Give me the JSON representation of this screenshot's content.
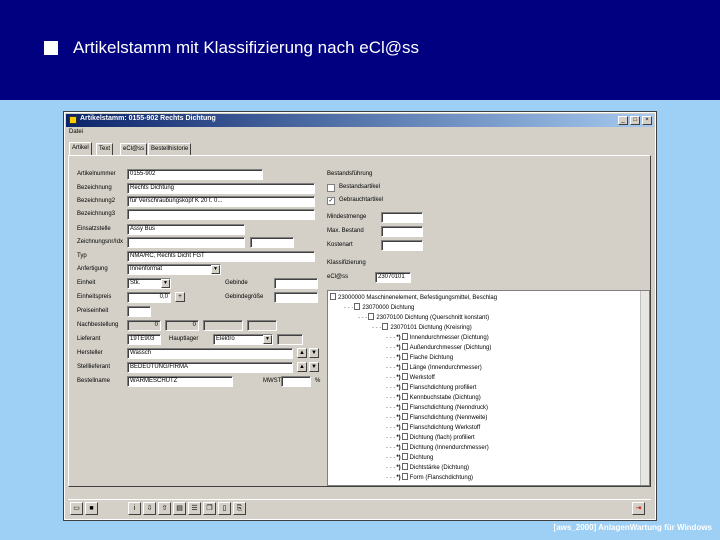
{
  "slide": {
    "title": "Artikelstamm mit Klassifizierung nach eCl@ss",
    "footer": "[aws_2000] AnlagenWartung für Windows"
  },
  "window": {
    "title": "Artikelstamm: 0155-902 Rechts Dichtung",
    "menu": [
      "Datei"
    ],
    "tabs": [
      "Artikel",
      "Text",
      "eCl@ss",
      "Bestellhistorie"
    ],
    "active_tab": "Artikel"
  },
  "form": {
    "artikelnummer": {
      "label": "Artikelnummer",
      "value": "0155-902"
    },
    "bezeichnung": {
      "label": "Bezeichnung",
      "value": "Rechts Dichtung"
    },
    "bezeichnung2": {
      "label": "Bezeichnung2",
      "value": "für Verschraubungskopf K 20 t. 0..."
    },
    "bezeichnung3": {
      "label": "Bezeichnung3",
      "value": ""
    },
    "einsatzstelle": {
      "label": "Einsatzstelle",
      "value": "Assy Bus"
    },
    "zeichnungsnr": {
      "label": "Zeichnungsnr/Idx",
      "value": ""
    },
    "typ": {
      "label": "Typ",
      "value": "NMA/RC, Rechts Dicht FGT"
    },
    "anfertigung": {
      "label": "Anfertigung",
      "value": "Innenformat"
    },
    "einheit": {
      "label": "Einheit",
      "value": "Stk."
    },
    "einheitspreis": {
      "label": "Einheitspreis",
      "value": "0,0"
    },
    "preiseinheit": {
      "label": "Preiseinheit",
      "value": ""
    },
    "nachbestellung": {
      "label": "Nachbestellung",
      "value": "0",
      "value2": "0"
    },
    "lieferant": {
      "label": "Lieferant",
      "value": "19TE903",
      "label2": "Hauptlager",
      "value2": "Elektro"
    },
    "hersteller": {
      "label": "Hersteller",
      "value": "Wassch"
    },
    "stelllieferant": {
      "label": "Stelllieferant",
      "value": "BEDEUTUNG/FIRMA"
    },
    "bestellname": {
      "label": "Bestellname",
      "value": "WÄRMESCHUTZ",
      "label2": "MWST",
      "value2": ""
    },
    "gebinde": {
      "label": "Gebinde",
      "value": ""
    },
    "gebindegroesse": {
      "label": "Gebindegröße",
      "value": ""
    }
  },
  "bestandsfuehrung": {
    "label": "Bestandsführung",
    "option1": {
      "label": "Bestandsartikel",
      "checked": false
    },
    "option2": {
      "label": "Gebrauchtartikel",
      "checked": true
    },
    "mindestmenge": {
      "label": "Mindestmenge",
      "value": ""
    },
    "mindestmenge2": {
      "label": "Max. Bestand",
      "value": ""
    },
    "kostenart": {
      "label": "Kostenart",
      "value": ""
    }
  },
  "klassifizierung": {
    "label": "Klassifizierung",
    "eclass_label": "eCl@ss",
    "eclass_value": "23070101",
    "tree": [
      {
        "text": "23000000 Maschinenelement, Befestigungsmittel, Beschlag",
        "indent": 0,
        "icon": true,
        "stars": ""
      },
      {
        "text": "23070000 Dichtung",
        "indent": 1,
        "icon": true,
        "stars": ""
      },
      {
        "text": "23070100 Dichtung (Querschnitt konstant)",
        "indent": 2,
        "icon": true,
        "stars": ""
      },
      {
        "text": "23070101 Dichtung (Kreisring)",
        "indent": 3,
        "icon": true,
        "stars": ""
      },
      {
        "text": "Innendurchmesser (Dichtung)",
        "indent": 4,
        "icon": true,
        "stars": "*)"
      },
      {
        "text": "Außendurchmesser (Dichtung)",
        "indent": 4,
        "icon": true,
        "stars": "*)"
      },
      {
        "text": "Flache Dichtung",
        "indent": 4,
        "icon": true,
        "stars": "*)"
      },
      {
        "text": "Länge (Innendurchmesser)",
        "indent": 4,
        "icon": true,
        "stars": "*)"
      },
      {
        "text": "Werkstoff",
        "indent": 4,
        "icon": true,
        "stars": "*)"
      },
      {
        "text": "Flanschdichtung profiliert",
        "indent": 4,
        "icon": true,
        "stars": "*)"
      },
      {
        "text": "Kennbuchstabe (Dichtung)",
        "indent": 4,
        "icon": true,
        "stars": "*)"
      },
      {
        "text": "Flanschdichtung (Nenndruck)",
        "indent": 4,
        "icon": true,
        "stars": "*)"
      },
      {
        "text": "Flanschdichtung (Nennweite)",
        "indent": 4,
        "icon": true,
        "stars": "*)"
      },
      {
        "text": "Flanschdichtung Werkstoff",
        "indent": 4,
        "icon": true,
        "stars": "*)"
      },
      {
        "text": "Dichtung (flach) profiliert",
        "indent": 4,
        "icon": true,
        "stars": "*)"
      },
      {
        "text": "Dichtung (Innendurchmesser)",
        "indent": 4,
        "icon": true,
        "stars": "*)"
      },
      {
        "text": "Dichtung",
        "indent": 4,
        "icon": true,
        "stars": "*)"
      },
      {
        "text": "Dichtstärke (Dichtung)",
        "indent": 4,
        "icon": true,
        "stars": "*)"
      },
      {
        "text": "Form (Flanschdichtung)",
        "indent": 4,
        "icon": true,
        "stars": "*)"
      }
    ]
  },
  "colors": {
    "header_bg": "#000080",
    "slide_bg": "#9ecff5",
    "window_bg": "#d4d0c8"
  }
}
